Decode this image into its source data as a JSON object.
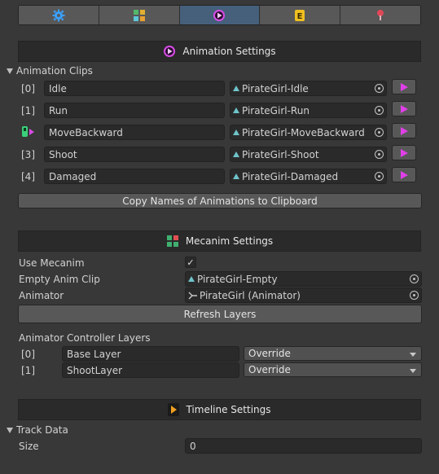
{
  "tabs": [
    {
      "icon": "gear-icon",
      "color": "#3aa0ff"
    },
    {
      "icon": "grid-icon",
      "color": "#e0b030"
    },
    {
      "icon": "play-circle-icon",
      "color": "#d84ce6"
    },
    {
      "icon": "event-icon",
      "color": "#f0c020"
    },
    {
      "icon": "pin-icon",
      "color": "#e04858"
    }
  ],
  "animation": {
    "header": "Animation Settings",
    "clips_label": "Animation Clips",
    "clips": [
      {
        "index": "[0]",
        "name": "Idle",
        "clip": "PirateGirl-Idle"
      },
      {
        "index": "[1]",
        "name": "Run",
        "clip": "PirateGirl-Run"
      },
      {
        "index": "",
        "name": "MoveBackward",
        "clip": "PirateGirl-MoveBackward"
      },
      {
        "index": "[3]",
        "name": "Shoot",
        "clip": "PirateGirl-Shoot"
      },
      {
        "index": "[4]",
        "name": "Damaged",
        "clip": "PirateGirl-Damaged"
      }
    ],
    "copy_button": "Copy Names of Animations to Clipboard"
  },
  "mecanim": {
    "header": "Mecanim Settings",
    "use_mecanim_label": "Use Mecanim",
    "use_mecanim_check": "✓",
    "empty_clip_label": "Empty Anim Clip",
    "empty_clip_value": "PirateGirl-Empty",
    "animator_label": "Animator",
    "animator_value": "PirateGirl (Animator)",
    "refresh_button": "Refresh Layers",
    "layers_label": "Animator Controller Layers",
    "layers": [
      {
        "index": "[0]",
        "name": "Base Layer",
        "mode": "Override"
      },
      {
        "index": "[1]",
        "name": "ShootLayer",
        "mode": "Override"
      }
    ]
  },
  "timeline": {
    "header": "Timeline Settings",
    "track_label": "Track Data",
    "size_label": "Size",
    "size_value": "0"
  }
}
